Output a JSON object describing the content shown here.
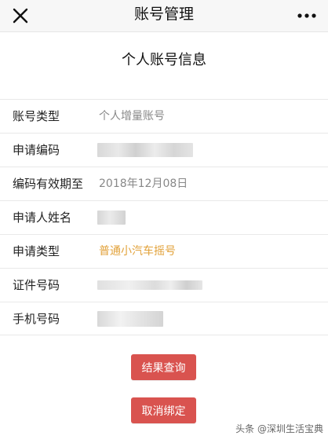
{
  "nav": {
    "title": "账号管理"
  },
  "section": {
    "title": "个人账号信息"
  },
  "rows": [
    {
      "label": "账号类型",
      "value": "个人增量账号"
    },
    {
      "label": "申请编码",
      "value": ""
    },
    {
      "label": "编码有效期至",
      "value": "2018年12月08日"
    },
    {
      "label": "申请人姓名",
      "value": ""
    },
    {
      "label": "申请类型",
      "value": "普通小汽车摇号"
    },
    {
      "label": "证件号码",
      "value": ""
    },
    {
      "label": "手机号码",
      "value": ""
    }
  ],
  "buttons": {
    "query": "结果查询",
    "unbind": "取消绑定"
  },
  "watermark": "头条 @深圳生活宝典",
  "colors": {
    "accent": "#e2a23a",
    "button": "#d9534f"
  },
  "icons": {
    "close": "close-icon",
    "more": "more-icon"
  }
}
